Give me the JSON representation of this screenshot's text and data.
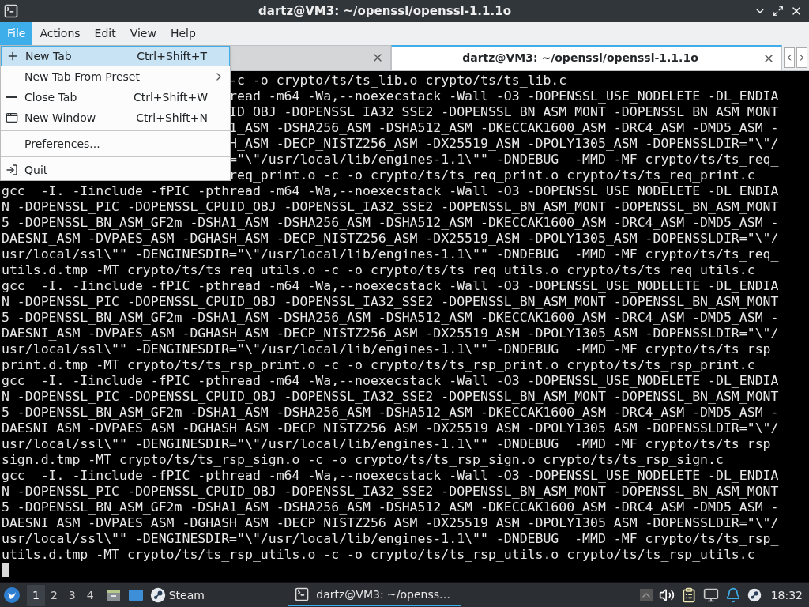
{
  "window": {
    "title": "dartz@VM3: ~/openssl/openssl-1.1.1o"
  },
  "menubar": [
    {
      "label": "File",
      "selected": true
    },
    {
      "label": "Actions",
      "selected": false
    },
    {
      "label": "Edit",
      "selected": false
    },
    {
      "label": "View",
      "selected": false
    },
    {
      "label": "Help",
      "selected": false
    }
  ],
  "file_menu": [
    {
      "kind": "item",
      "label": "New Tab",
      "shortcut": "Ctrl+Shift+T",
      "selected": true
    },
    {
      "kind": "submenu",
      "label": "New Tab From Preset",
      "selected": false
    },
    {
      "kind": "item",
      "label": "Close Tab",
      "shortcut": "Ctrl+Shift+W",
      "selected": false
    },
    {
      "kind": "item",
      "label": "New Window",
      "shortcut": "Ctrl+Shift+N",
      "selected": false
    },
    {
      "kind": "separator"
    },
    {
      "kind": "item",
      "label": "Preferences...",
      "selected": false
    },
    {
      "kind": "separator"
    },
    {
      "kind": "item",
      "label": "Quit",
      "selected": false
    }
  ],
  "tabs": [
    {
      "selected": false
    },
    {
      "label": "dartz@VM3: ~/openssl/openssl-1.1.1o",
      "selected": true
    }
  ],
  "terminal_lines": [
    {
      "kind": "covered",
      "text": "-c -o crypto/ts/ts_lib.o crypto/ts/ts_lib.c"
    },
    {
      "kind": "covered",
      "text": "read -m64 -Wa,--noexecstack -Wall -O3 -DOPENSSL_USE_NODELETE -DL_ENDIA"
    },
    {
      "kind": "covered",
      "text": "ID_OBJ -DOPENSSL_IA32_SSE2 -DOPENSSL_BN_ASM_MONT -DOPENSSL_BN_ASM_MONT"
    },
    {
      "kind": "covered",
      "text": "1_ASM -DSHA256_ASM -DSHA512_ASM -DKECCAK1600_ASM -DRC4_ASM -DMD5_ASM -"
    },
    {
      "kind": "covered",
      "text": "H_ASM -DECP_NISTZ256_ASM -DX25519_ASM -DPOLY1305_ASM -DOPENSSLDIR=\"\\\"/"
    },
    {
      "kind": "covered",
      "text": "=\"\\\"/usr/local/lib/engines-1.1\\\"\" -DNDEBUG  -MMD -MF crypto/ts/ts_req_"
    },
    {
      "kind": "covered",
      "text": "req_print.o -c -o crypto/ts/ts_req_print.o crypto/ts/ts_req_print.c"
    },
    {
      "kind": "full",
      "text": "gcc  -I. -Iinclude -fPIC -pthread -m64 -Wa,--noexecstack -Wall -O3 -DOPENSSL_USE_NODELETE -DL_ENDIA"
    },
    {
      "kind": "full",
      "text": "N -DOPENSSL_PIC -DOPENSSL_CPUID_OBJ -DOPENSSL_IA32_SSE2 -DOPENSSL_BN_ASM_MONT -DOPENSSL_BN_ASM_MONT"
    },
    {
      "kind": "full",
      "text": "5 -DOPENSSL_BN_ASM_GF2m -DSHA1_ASM -DSHA256_ASM -DSHA512_ASM -DKECCAK1600_ASM -DRC4_ASM -DMD5_ASM -"
    },
    {
      "kind": "full",
      "text": "DAESNI_ASM -DVPAES_ASM -DGHASH_ASM -DECP_NISTZ256_ASM -DX25519_ASM -DPOLY1305_ASM -DOPENSSLDIR=\"\\\"/"
    },
    {
      "kind": "full",
      "text": "usr/local/ssl\\\"\" -DENGINESDIR=\"\\\"/usr/local/lib/engines-1.1\\\"\" -DNDEBUG  -MMD -MF crypto/ts/ts_req_"
    },
    {
      "kind": "full",
      "text": "utils.d.tmp -MT crypto/ts/ts_req_utils.o -c -o crypto/ts/ts_req_utils.o crypto/ts/ts_req_utils.c"
    },
    {
      "kind": "full",
      "text": "gcc  -I. -Iinclude -fPIC -pthread -m64 -Wa,--noexecstack -Wall -O3 -DOPENSSL_USE_NODELETE -DL_ENDIA"
    },
    {
      "kind": "full",
      "text": "N -DOPENSSL_PIC -DOPENSSL_CPUID_OBJ -DOPENSSL_IA32_SSE2 -DOPENSSL_BN_ASM_MONT -DOPENSSL_BN_ASM_MONT"
    },
    {
      "kind": "full",
      "text": "5 -DOPENSSL_BN_ASM_GF2m -DSHA1_ASM -DSHA256_ASM -DSHA512_ASM -DKECCAK1600_ASM -DRC4_ASM -DMD5_ASM -"
    },
    {
      "kind": "full",
      "text": "DAESNI_ASM -DVPAES_ASM -DGHASH_ASM -DECP_NISTZ256_ASM -DX25519_ASM -DPOLY1305_ASM -DOPENSSLDIR=\"\\\"/"
    },
    {
      "kind": "full",
      "text": "usr/local/ssl\\\"\" -DENGINESDIR=\"\\\"/usr/local/lib/engines-1.1\\\"\" -DNDEBUG  -MMD -MF crypto/ts/ts_rsp_"
    },
    {
      "kind": "full",
      "text": "print.d.tmp -MT crypto/ts/ts_rsp_print.o -c -o crypto/ts/ts_rsp_print.o crypto/ts/ts_rsp_print.c"
    },
    {
      "kind": "full",
      "text": "gcc  -I. -Iinclude -fPIC -pthread -m64 -Wa,--noexecstack -Wall -O3 -DOPENSSL_USE_NODELETE -DL_ENDIA"
    },
    {
      "kind": "full",
      "text": "N -DOPENSSL_PIC -DOPENSSL_CPUID_OBJ -DOPENSSL_IA32_SSE2 -DOPENSSL_BN_ASM_MONT -DOPENSSL_BN_ASM_MONT"
    },
    {
      "kind": "full",
      "text": "5 -DOPENSSL_BN_ASM_GF2m -DSHA1_ASM -DSHA256_ASM -DSHA512_ASM -DKECCAK1600_ASM -DRC4_ASM -DMD5_ASM -"
    },
    {
      "kind": "full",
      "text": "DAESNI_ASM -DVPAES_ASM -DGHASH_ASM -DECP_NISTZ256_ASM -DX25519_ASM -DPOLY1305_ASM -DOPENSSLDIR=\"\\\"/"
    },
    {
      "kind": "full",
      "text": "usr/local/ssl\\\"\" -DENGINESDIR=\"\\\"/usr/local/lib/engines-1.1\\\"\" -DNDEBUG  -MMD -MF crypto/ts/ts_rsp_"
    },
    {
      "kind": "full",
      "text": "sign.d.tmp -MT crypto/ts/ts_rsp_sign.o -c -o crypto/ts/ts_rsp_sign.o crypto/ts/ts_rsp_sign.c"
    },
    {
      "kind": "full",
      "text": "gcc  -I. -Iinclude -fPIC -pthread -m64 -Wa,--noexecstack -Wall -O3 -DOPENSSL_USE_NODELETE -DL_ENDIA"
    },
    {
      "kind": "full",
      "text": "N -DOPENSSL_PIC -DOPENSSL_CPUID_OBJ -DOPENSSL_IA32_SSE2 -DOPENSSL_BN_ASM_MONT -DOPENSSL_BN_ASM_MONT"
    },
    {
      "kind": "full",
      "text": "5 -DOPENSSL_BN_ASM_GF2m -DSHA1_ASM -DSHA256_ASM -DSHA512_ASM -DKECCAK1600_ASM -DRC4_ASM -DMD5_ASM -"
    },
    {
      "kind": "full",
      "text": "DAESNI_ASM -DVPAES_ASM -DGHASH_ASM -DECP_NISTZ256_ASM -DX25519_ASM -DPOLY1305_ASM -DOPENSSLDIR=\"\\\"/"
    },
    {
      "kind": "full",
      "text": "usr/local/ssl\\\"\" -DENGINESDIR=\"\\\"/usr/local/lib/engines-1.1\\\"\" -DNDEBUG  -MMD -MF crypto/ts/ts_rsp_"
    },
    {
      "kind": "full",
      "text": "utils.d.tmp -MT crypto/ts/ts_rsp_utils.o -c -o crypto/ts/ts_rsp_utils.o crypto/ts/ts_rsp_utils.c"
    }
  ],
  "taskbar": {
    "workspaces": [
      {
        "label": "1",
        "selected": true
      },
      {
        "label": "2",
        "selected": false
      },
      {
        "label": "3",
        "selected": false
      },
      {
        "label": "4",
        "selected": false
      }
    ],
    "launchers": [
      {
        "kind": "files"
      },
      {
        "kind": "desktop"
      },
      {
        "kind": "steam",
        "label": "Steam"
      }
    ],
    "tasks": [
      {
        "label": "dartz@VM3: ~/openss…",
        "selected": true
      }
    ],
    "clock": "18:32"
  }
}
